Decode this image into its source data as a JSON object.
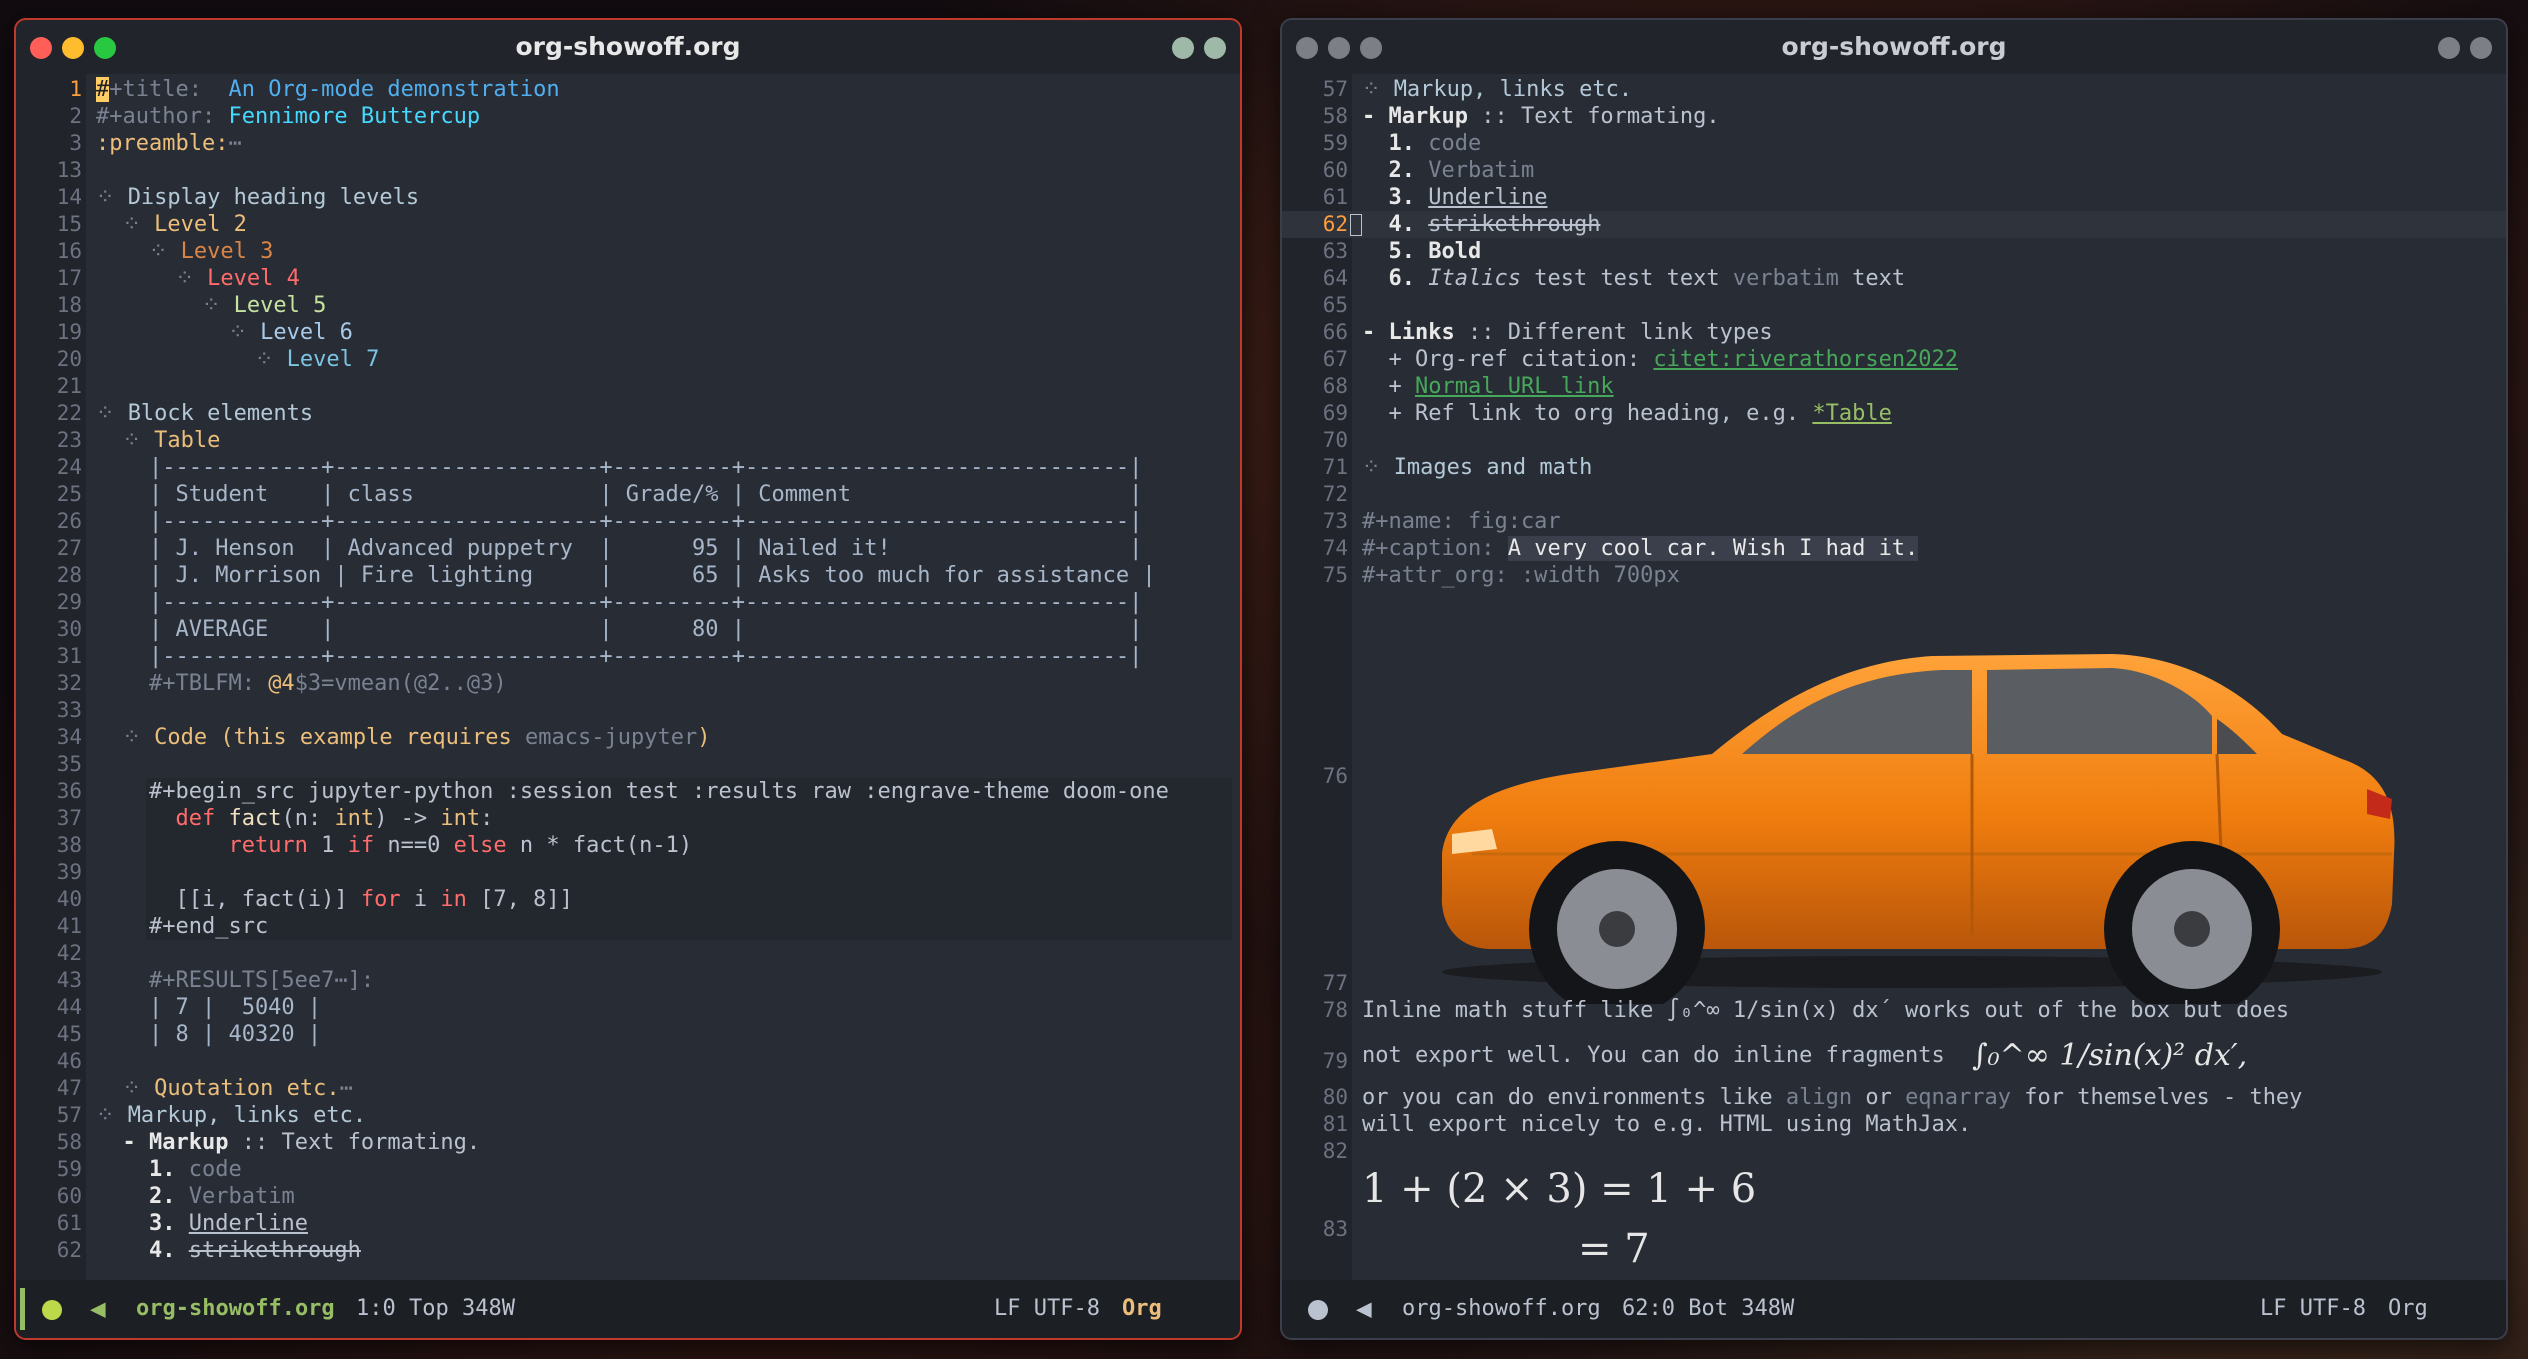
{
  "left_window": {
    "title": "org-showoff.org",
    "lines": [
      {
        "n": "1",
        "segs": [
          [
            "#",
            "cursor"
          ],
          [
            "+title:  ",
            "c-meta"
          ],
          [
            "An Org-mode demonstration",
            "c-title"
          ]
        ]
      },
      {
        "n": "2",
        "segs": [
          [
            "#+author: ",
            "c-meta"
          ],
          [
            "Fennimore Buttercup",
            "c-author"
          ]
        ]
      },
      {
        "n": "3",
        "segs": [
          [
            ":preamble:",
            "c-kw"
          ],
          [
            "⋯",
            "c-dim"
          ]
        ]
      },
      {
        "n": "13",
        "segs": []
      },
      {
        "n": "14",
        "segs": [
          [
            "⁘ ",
            "c-dim"
          ],
          [
            "Display heading levels",
            "c-h1"
          ]
        ]
      },
      {
        "n": "15",
        "segs": [
          [
            "  ⁘ ",
            "c-dim"
          ],
          [
            "Level 2",
            "c-h2"
          ]
        ]
      },
      {
        "n": "16",
        "segs": [
          [
            "    ⁘ ",
            "c-dim"
          ],
          [
            "Level 3",
            "c-h3"
          ]
        ]
      },
      {
        "n": "17",
        "segs": [
          [
            "      ⁘ ",
            "c-dim"
          ],
          [
            "Level 4",
            "c-h4"
          ]
        ]
      },
      {
        "n": "18",
        "segs": [
          [
            "        ⁘ ",
            "c-dim"
          ],
          [
            "Level 5",
            "c-h5"
          ]
        ]
      },
      {
        "n": "19",
        "segs": [
          [
            "          ⁘ ",
            "c-dim"
          ],
          [
            "Level 6",
            "c-h6"
          ]
        ]
      },
      {
        "n": "20",
        "segs": [
          [
            "            ⁘ ",
            "c-dim"
          ],
          [
            "Level 7",
            "c-h7"
          ]
        ]
      },
      {
        "n": "21",
        "segs": []
      },
      {
        "n": "22",
        "segs": [
          [
            "⁘ ",
            "c-dim"
          ],
          [
            "Block elements",
            "c-h1"
          ]
        ]
      },
      {
        "n": "23",
        "segs": [
          [
            "  ⁘ ",
            "c-dim"
          ],
          [
            "Table",
            "c-h2"
          ]
        ]
      },
      {
        "n": "24",
        "segs": [
          [
            "    |------------+--------------------+---------+-----------------------------|",
            "c-tbl"
          ]
        ]
      },
      {
        "n": "25",
        "segs": [
          [
            "    | Student    | class              | Grade/% | Comment                     |",
            "c-tbl"
          ]
        ]
      },
      {
        "n": "26",
        "segs": [
          [
            "    |------------+--------------------+---------+-----------------------------|",
            "c-tbl"
          ]
        ]
      },
      {
        "n": "27",
        "segs": [
          [
            "    | J. Henson  | Advanced puppetry  |      95 | Nailed it!                  |",
            "c-tbl"
          ]
        ]
      },
      {
        "n": "28",
        "segs": [
          [
            "    | J. Morrison | Fire lighting     |      65 | Asks too much for assistance |",
            "c-tbl"
          ]
        ]
      },
      {
        "n": "29",
        "segs": [
          [
            "    |------------+--------------------+---------+-----------------------------|",
            "c-tbl"
          ]
        ]
      },
      {
        "n": "30",
        "segs": [
          [
            "    | AVERAGE    |                    |      80 |                             |",
            "c-tbl"
          ]
        ]
      },
      {
        "n": "31",
        "segs": [
          [
            "    |------------+--------------------+---------+-----------------------------|",
            "c-tbl"
          ]
        ]
      },
      {
        "n": "32",
        "segs": [
          [
            "    #+TBLFM: ",
            "c-dim"
          ],
          [
            "@4",
            "c-kw"
          ],
          [
            "$3=vmean(@2..@3)",
            "c-dim"
          ]
        ]
      },
      {
        "n": "33",
        "segs": []
      },
      {
        "n": "34",
        "segs": [
          [
            "  ⁘ ",
            "c-dim"
          ],
          [
            "Code (this example requires ",
            "c-h2"
          ],
          [
            "emacs-jupyter",
            "c-dim"
          ],
          [
            ")",
            "c-h2"
          ]
        ]
      },
      {
        "n": "35",
        "segs": []
      },
      {
        "n": "36",
        "segs": [
          [
            "    #+begin_src jupyter-python :session test :results raw :engrave-theme doom-one ",
            "src"
          ]
        ]
      },
      {
        "n": "37",
        "segs": [
          [
            "      ",
            "src"
          ],
          [
            "def ",
            "c-red src"
          ],
          [
            "fact",
            "c-fn src"
          ],
          [
            "(n: ",
            "src"
          ],
          [
            "int",
            "c-type src"
          ],
          [
            ") -> ",
            "src"
          ],
          [
            "int",
            "c-type src"
          ],
          [
            ":",
            "src"
          ]
        ]
      },
      {
        "n": "38",
        "segs": [
          [
            "          ",
            "src"
          ],
          [
            "return ",
            "c-red src"
          ],
          [
            "1 ",
            "src"
          ],
          [
            "if ",
            "c-red src"
          ],
          [
            "n==0 ",
            "src"
          ],
          [
            "else ",
            "c-red src"
          ],
          [
            "n * fact(n-1)",
            "src"
          ]
        ]
      },
      {
        "n": "39",
        "segs": [
          [
            "",
            "src"
          ]
        ]
      },
      {
        "n": "40",
        "segs": [
          [
            "      [[i, fact(i)] ",
            "src"
          ],
          [
            "for ",
            "c-red src"
          ],
          [
            "i ",
            "src"
          ],
          [
            "in ",
            "c-red src"
          ],
          [
            "[7, 8]]",
            "src"
          ]
        ]
      },
      {
        "n": "41",
        "segs": [
          [
            "    #+end_src ",
            "src"
          ]
        ]
      },
      {
        "n": "42",
        "segs": []
      },
      {
        "n": "43",
        "segs": [
          [
            "    #+RESULTS[5ee7⋯]:",
            "c-dim"
          ]
        ]
      },
      {
        "n": "44",
        "segs": [
          [
            "    | 7 |  5040 |",
            "c-tbl"
          ]
        ]
      },
      {
        "n": "45",
        "segs": [
          [
            "    | 8 | 40320 |",
            "c-tbl"
          ]
        ]
      },
      {
        "n": "46",
        "segs": []
      },
      {
        "n": "47",
        "segs": [
          [
            "  ⁘ ",
            "c-dim"
          ],
          [
            "Quotation etc.",
            "c-h2"
          ],
          [
            "⋯",
            "c-dim"
          ]
        ]
      },
      {
        "n": "57",
        "segs": [
          [
            "⁘ ",
            "c-dim"
          ],
          [
            "Markup, links etc.",
            "c-h1"
          ]
        ]
      },
      {
        "n": "58",
        "segs": [
          [
            "  - ",
            "b"
          ],
          [
            "Markup",
            "b"
          ],
          [
            " :: Text formating.",
            ""
          ]
        ]
      },
      {
        "n": "59",
        "segs": [
          [
            "    ",
            ""
          ],
          [
            "1.",
            "b"
          ],
          [
            " code",
            "c-dim"
          ]
        ]
      },
      {
        "n": "60",
        "segs": [
          [
            "    ",
            ""
          ],
          [
            "2.",
            "b"
          ],
          [
            " Verbatim",
            "c-dim"
          ]
        ]
      },
      {
        "n": "61",
        "segs": [
          [
            "    ",
            ""
          ],
          [
            "3.",
            "b"
          ],
          [
            " ",
            ""
          ],
          [
            "Underline",
            "u"
          ]
        ]
      },
      {
        "n": "62",
        "segs": [
          [
            "    ",
            ""
          ],
          [
            "4.",
            "b"
          ],
          [
            " ",
            ""
          ],
          [
            "strikethrough",
            "s"
          ]
        ]
      }
    ],
    "modeline": {
      "file": "org-showoff.org",
      "pos": "1:0 Top 348W",
      "enc": "LF UTF-8",
      "mode": "Org"
    }
  },
  "right_window": {
    "title": "org-showoff.org",
    "lines": [
      {
        "n": "57",
        "segs": [
          [
            "⁘ ",
            "c-dim"
          ],
          [
            "Markup, links etc.",
            "c-h1"
          ]
        ]
      },
      {
        "n": "58",
        "segs": [
          [
            "- ",
            "b"
          ],
          [
            "Markup",
            "b"
          ],
          [
            " :: Text formating.",
            ""
          ]
        ]
      },
      {
        "n": "59",
        "segs": [
          [
            "  ",
            ""
          ],
          [
            "1.",
            "b"
          ],
          [
            " code",
            "c-dim"
          ]
        ]
      },
      {
        "n": "60",
        "segs": [
          [
            "  ",
            ""
          ],
          [
            "2.",
            "b"
          ],
          [
            " Verbatim",
            "c-dim"
          ]
        ]
      },
      {
        "n": "61",
        "segs": [
          [
            "  ",
            ""
          ],
          [
            "3.",
            "b"
          ],
          [
            " ",
            ""
          ],
          [
            "Underline",
            "u"
          ]
        ]
      },
      {
        "n": "62",
        "cur": true,
        "segs": [
          [
            "  ",
            ""
          ],
          [
            "4.",
            "b"
          ],
          [
            " ",
            ""
          ],
          [
            "strikethrough",
            "s"
          ]
        ]
      },
      {
        "n": "63",
        "segs": [
          [
            "  ",
            ""
          ],
          [
            "5.",
            "b"
          ],
          [
            " ",
            ""
          ],
          [
            "Bold",
            "b"
          ]
        ]
      },
      {
        "n": "64",
        "segs": [
          [
            "  ",
            ""
          ],
          [
            "6.",
            "b"
          ],
          [
            " ",
            ""
          ],
          [
            "Italics",
            "i"
          ],
          [
            " test test text ",
            ""
          ],
          [
            "verbatim",
            "c-dim"
          ],
          [
            " text",
            ""
          ]
        ]
      },
      {
        "n": "65",
        "segs": []
      },
      {
        "n": "66",
        "segs": [
          [
            "- ",
            "b"
          ],
          [
            "Links",
            "b"
          ],
          [
            " :: Different link types",
            ""
          ]
        ]
      },
      {
        "n": "67",
        "segs": [
          [
            "  + Org-ref citation: ",
            ""
          ],
          [
            "citet:riverathorsen2022",
            "c-link"
          ]
        ]
      },
      {
        "n": "68",
        "segs": [
          [
            "  + ",
            ""
          ],
          [
            "Normal URL link",
            "c-link"
          ]
        ]
      },
      {
        "n": "69",
        "segs": [
          [
            "  + Ref link to org heading, e.g. ",
            ""
          ],
          [
            "*Table",
            "c-ref"
          ]
        ]
      },
      {
        "n": "70",
        "segs": []
      },
      {
        "n": "71",
        "segs": [
          [
            "⁘ ",
            "c-dim"
          ],
          [
            "Images and math",
            "c-h1"
          ]
        ]
      },
      {
        "n": "72",
        "segs": []
      },
      {
        "n": "73",
        "segs": [
          [
            "#+name: fig:car",
            "c-dim"
          ]
        ]
      },
      {
        "n": "74",
        "segs": [
          [
            "#+caption: ",
            "c-dim"
          ],
          [
            "A very cool car. Wish I had it.",
            "hl"
          ]
        ]
      },
      {
        "n": "75",
        "segs": [
          [
            "#+attr_org: :width 700px",
            "c-dim"
          ]
        ]
      }
    ],
    "line76": "76",
    "line77": "77",
    "line78": {
      "n": "78",
      "a": "Inline math stuff like ∫₀^∞ 1/sin(x) dx´ works out of the box but does"
    },
    "line79": {
      "n": "79",
      "a": "not export well. You can do inline fragments",
      "math": "∫₀^∞ 1/sin(x)² dx′,"
    },
    "line80": {
      "n": "80",
      "a": "or you can do environments like ",
      "b": "align",
      "c": " or ",
      "d": "eqnarray",
      "e": " for themselves - they"
    },
    "line81": {
      "n": "81",
      "a": "will export nicely to e.g. HTML using MathJax."
    },
    "line82": "82",
    "line83": {
      "n": "83",
      "eq1": "1 + (2 × 3) = 1 + 6",
      "eq2": "= 7"
    },
    "modeline": {
      "file": "org-showoff.org",
      "pos": "62:0 Bot 348W",
      "enc": "LF UTF-8",
      "mode": "Org"
    }
  },
  "colors": {
    "accent": "#c0392b",
    "bg": "#282c34",
    "orange": "#ff9e3b",
    "green": "#98be65",
    "yellow": "#ecbe7b"
  },
  "icons": {
    "close": "close-icon",
    "min": "minimize-icon",
    "max": "maximize-icon",
    "mode": "emacs-icon"
  }
}
